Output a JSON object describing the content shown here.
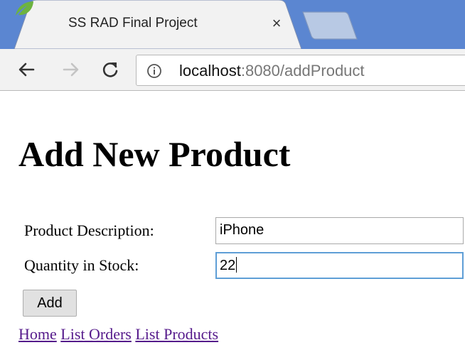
{
  "browser": {
    "tab_title": "SS RAD Final Project",
    "close_glyph": "×",
    "url_host": "localhost",
    "url_rest": ":8080/addProduct",
    "icons": {
      "favicon": "spring-leaf-icon",
      "back": "back-arrow-icon",
      "forward": "forward-arrow-icon",
      "reload": "reload-icon",
      "info": "info-icon"
    },
    "colors": {
      "tabstrip": "#5b86d1",
      "active_tab": "#f2f2f2",
      "inactive_tab": "#b8c9e4"
    }
  },
  "page": {
    "title": "Add New Product",
    "form": {
      "description_label": "Product Description:",
      "description_value": "iPhone",
      "quantity_label": "Quantity in Stock:",
      "quantity_value": "22",
      "submit_label": "Add"
    },
    "links": [
      "Home",
      "List Orders",
      "List Products"
    ],
    "colors": {
      "link": "#551a8b",
      "focus_border": "#5e9ed6"
    }
  }
}
